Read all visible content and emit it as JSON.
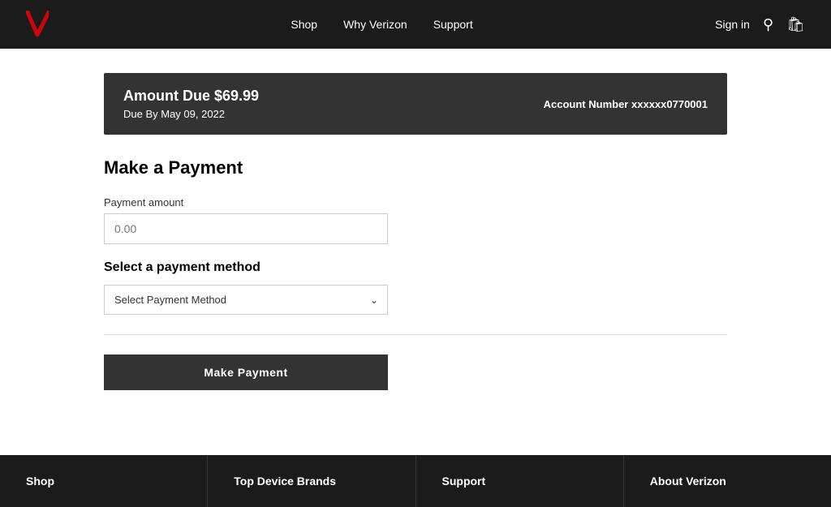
{
  "header": {
    "nav_items": [
      "Shop",
      "Why Verizon",
      "Support"
    ],
    "sign_in_label": "Sign in"
  },
  "banner": {
    "amount_title": "Amount Due $69.99",
    "due_date": "Due By May 09, 2022",
    "account_label": "Account Number",
    "account_number": "xxxxxx0770001"
  },
  "page": {
    "title": "Make a Payment",
    "payment_amount_label": "Payment amount",
    "payment_amount_placeholder": "0.00",
    "select_method_title": "Select a payment method",
    "select_placeholder": "Select Payment Method",
    "make_payment_button": "Make Payment"
  },
  "footer": {
    "columns": [
      {
        "title": "Shop"
      },
      {
        "title": "Top Device Brands"
      },
      {
        "title": "Support"
      },
      {
        "title": "About Verizon"
      }
    ]
  }
}
